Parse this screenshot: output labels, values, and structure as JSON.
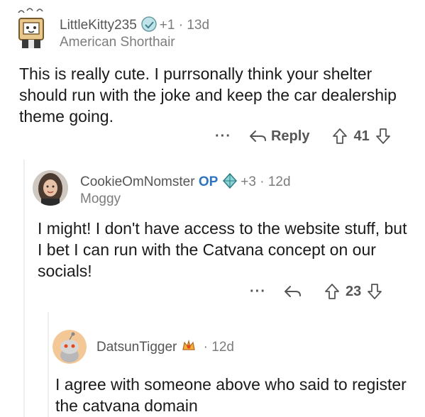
{
  "comments": [
    {
      "username": "LittleKitty235",
      "award_count": "+1",
      "separator": "·",
      "age": "13d",
      "flair": "American Shorthair",
      "body": "This is really cute.  I purrsonally think your shelter should run with the joke and keep the car dealership theme going.",
      "more_label": "···",
      "reply_label": "Reply",
      "score": "41"
    },
    {
      "username": "CookieOmNomster",
      "op_label": "OP",
      "award_count": "+3",
      "separator": "·",
      "age": "12d",
      "flair": "Moggy",
      "body": "I might! I don't have access to the website stuff, but I bet I can run with the Catvana concept on our socials!",
      "more_label": "···",
      "score": "23"
    },
    {
      "username": "DatsunTigger",
      "separator": "·",
      "age": "12d",
      "body": "I agree with someone above who said to register the catvana domain"
    }
  ],
  "icons": {
    "reply": "reply-arrow-icon",
    "upvote": "upvote-arrow-icon",
    "downvote": "downvote-arrow-icon",
    "award": "award-icon"
  },
  "colors": {
    "op_blue": "#2f74c0",
    "text": "#1a1a1b",
    "meta": "#7c7c7c"
  }
}
